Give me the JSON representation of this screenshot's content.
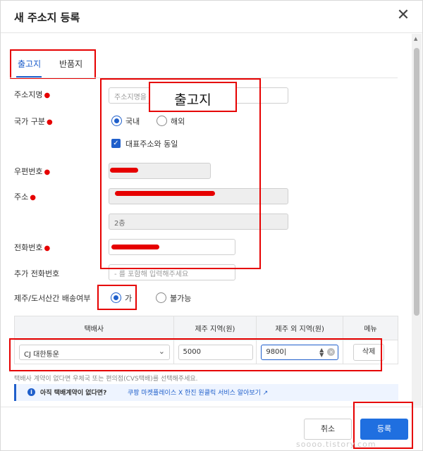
{
  "dialog": {
    "title": "새 주소지 등록",
    "close_glyph": "✕"
  },
  "tabs": [
    {
      "label": "출고지",
      "active": true
    },
    {
      "label": "반품지",
      "active": false
    }
  ],
  "form": {
    "address_name": {
      "label": "주소지명",
      "placeholder": "주소지명을 입력해주세요",
      "overlay": "출고지"
    },
    "country": {
      "label": "국가 구분",
      "options": [
        "국내",
        "해외"
      ],
      "selected": "국내"
    },
    "same_as_rep": {
      "label": "대표주소와 동일",
      "checked": true
    },
    "postal": {
      "label": "우편번호"
    },
    "address": {
      "label": "주소",
      "detail": "2층"
    },
    "phone": {
      "label": "전화번호"
    },
    "extra_phone": {
      "label": "추가 전화번호",
      "placeholder": "- 를 포함해 입력해주세요"
    },
    "jeju": {
      "label": "제주/도서산간 배송여부",
      "options": [
        "가",
        "불가능"
      ],
      "selected": "가"
    }
  },
  "courier_table": {
    "headers": [
      "택배사",
      "제주 지역(원)",
      "제주 외 지역(원)",
      "메뉴"
    ],
    "row": {
      "courier": "CJ 대한통운",
      "jeju_fee": "5000",
      "other_fee": "9800",
      "delete_label": "삭제"
    }
  },
  "hint": "택배사 계약이 없다면 우체국 또는 편의점(CVS택배)를 선택해주세요.",
  "info": {
    "text": "아직 택배계약이 없다면?",
    "link": "쿠팡 마켓플레이스 X 한진 원클릭 서비스 알아보기 ↗"
  },
  "footer": {
    "cancel_label": "취소",
    "submit_label": "등록"
  },
  "watermark": "soooo.tistory.com",
  "colors": {
    "accent": "#1f5fcb",
    "annotation": "#e60000",
    "submit": "#1f6fe0"
  }
}
